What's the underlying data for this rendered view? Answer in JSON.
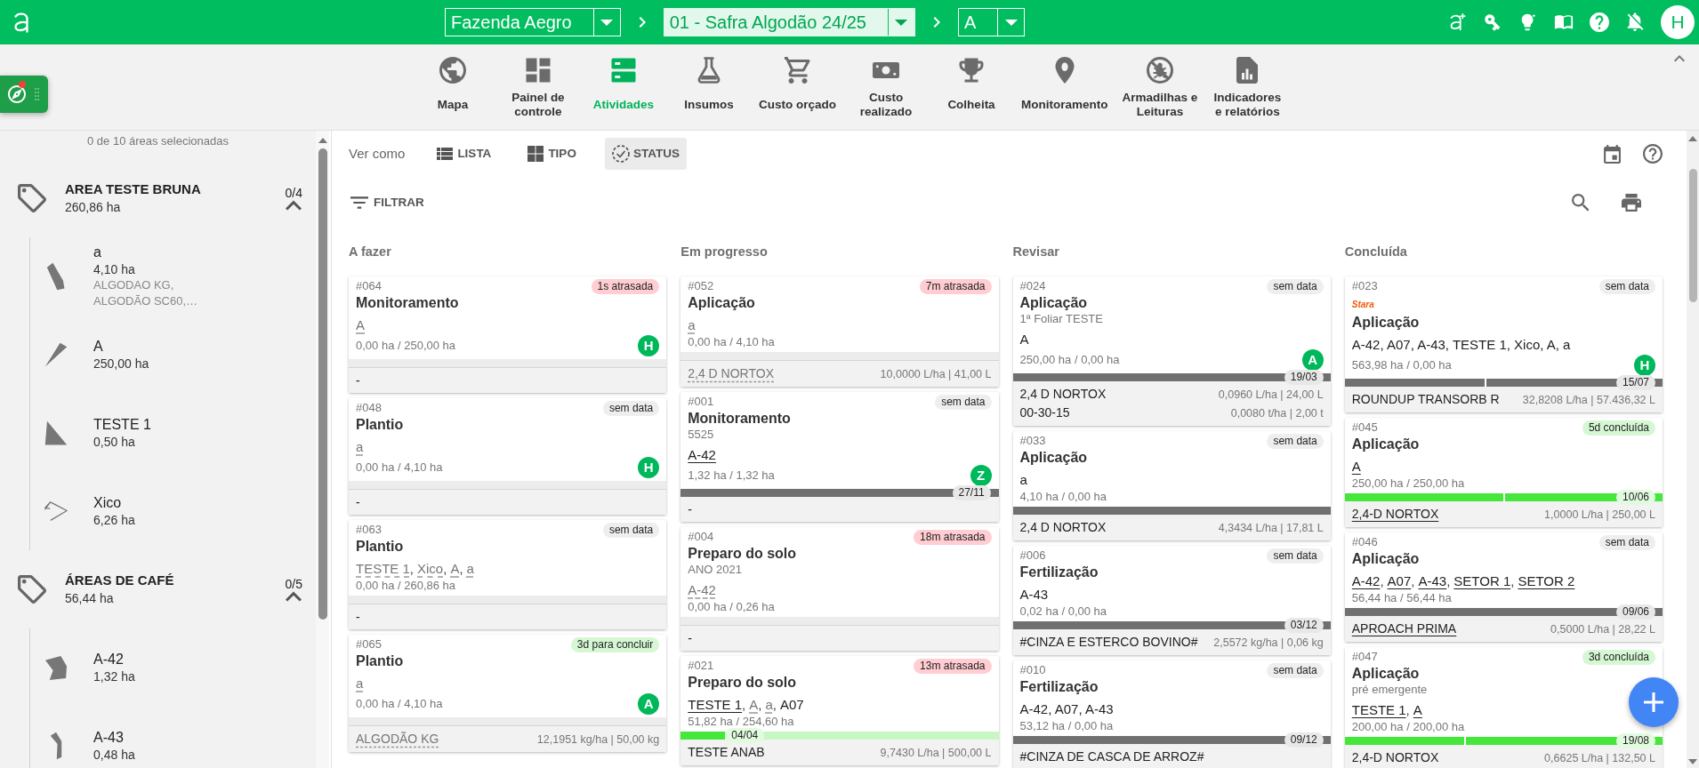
{
  "topbar": {
    "selectors": [
      {
        "label": "Fazenda Aegro",
        "active": false
      },
      {
        "label": "01 - Safra Algodão 24/25",
        "active": true
      },
      {
        "label": "A",
        "active": false
      }
    ],
    "avatar": "H"
  },
  "nav": {
    "items": [
      {
        "label": "Mapa",
        "selected": false
      },
      {
        "label": "Painel de\ncontrole",
        "selected": false
      },
      {
        "label": "Atividades",
        "selected": true
      },
      {
        "label": "Insumos",
        "selected": false
      },
      {
        "label": "Custo orçado",
        "selected": false
      },
      {
        "label": "Custo\nrealizado",
        "selected": false
      },
      {
        "label": "Colheita",
        "selected": false
      },
      {
        "label": "Monitoramento",
        "selected": false
      },
      {
        "label": "Armadilhas e\nLeituras",
        "selected": false
      },
      {
        "label": "Indicadores\ne relatórios",
        "selected": false
      }
    ]
  },
  "sidebar": {
    "summary": "0 de 10 áreas selecionadas",
    "groups": [
      {
        "name": "AREA TESTE BRUNA",
        "area": "260,86 ha",
        "count": "0/4",
        "expanded": true,
        "children": [
          {
            "name": "a",
            "area": "4,10 ha",
            "crops": "ALGODAO KG, ALGODÃO SC60,…"
          },
          {
            "name": "A",
            "area": "250,00 ha"
          },
          {
            "name": "TESTE 1",
            "area": "0,50 ha"
          },
          {
            "name": "Xico",
            "area": "6,26 ha"
          }
        ]
      },
      {
        "name": "ÁREAS DE CAFÉ",
        "area": "56,44 ha",
        "count": "0/5",
        "expanded": true,
        "children": [
          {
            "name": "A-42",
            "area": "1,32 ha"
          },
          {
            "name": "A-43",
            "area": "0,48 ha"
          }
        ]
      }
    ]
  },
  "view": {
    "label": "Ver como",
    "options": [
      {
        "label": "LISTA",
        "selected": false
      },
      {
        "label": "TIPO",
        "selected": false
      },
      {
        "label": "STATUS",
        "selected": true
      }
    ],
    "filter": "FILTRAR"
  },
  "columns": [
    {
      "title": "A fazer",
      "cards": [
        {
          "number": "#064",
          "badge": {
            "text": "1s atrasada",
            "color": "#ffcdd2"
          },
          "title": "Monitoramento",
          "areas": [
            {
              "name": "A",
              "kind": "dashed"
            }
          ],
          "ratio": "0,00 ha / 250,00 ha",
          "assignee": "H",
          "products": [
            {
              "name": "-",
              "kind": "plain"
            }
          ]
        },
        {
          "number": "#048",
          "badge": {
            "text": "sem data",
            "color": "#eeeeee"
          },
          "title": "Plantio",
          "areas": [
            {
              "name": "a",
              "kind": "dashed"
            }
          ],
          "ratio": "0,00 ha / 4,10 ha",
          "assignee": "H",
          "products": [
            {
              "name": "-",
              "kind": "plain"
            }
          ]
        },
        {
          "number": "#063",
          "badge": {
            "text": "sem data",
            "color": "#eeeeee"
          },
          "title": "Plantio",
          "areas": [
            {
              "name": "TESTE 1",
              "kind": "dashed",
              "suffix": ","
            },
            {
              "name": "Xico",
              "kind": "dashed",
              "suffix": ","
            },
            {
              "name": "A",
              "kind": "dashed",
              "suffix": ","
            },
            {
              "name": "a",
              "kind": "dashed"
            }
          ],
          "ratio": "0,00 ha / 260,86 ha",
          "products": [
            {
              "name": "-",
              "kind": "plain"
            }
          ]
        },
        {
          "number": "#065",
          "badge": {
            "text": "3d para concluir",
            "color": "#d5f7d3"
          },
          "title": "Plantio",
          "areas": [
            {
              "name": "a",
              "kind": "dashed"
            }
          ],
          "ratio": "0,00 ha / 4,10 ha",
          "assignee": "A",
          "products": [
            {
              "name": "ALGODÃO KG",
              "kind": "dashed",
              "dose": "12,1951 kg/ha | 50,00 kg"
            }
          ]
        }
      ]
    },
    {
      "title": "Em progresso",
      "cards": [
        {
          "number": "#052",
          "badge": {
            "text": "7m atrasada",
            "color": "#ffcdd2"
          },
          "title": "Aplicação",
          "areas": [
            {
              "name": "a",
              "kind": "dashed"
            }
          ],
          "ratio": "0,00 ha / 4,10 ha",
          "products": [
            {
              "name": "2,4 D NORTOX",
              "kind": "dashed",
              "dose": "10,0000 L/ha | 41,00 L"
            }
          ]
        },
        {
          "number": "#001",
          "badge": {
            "text": "sem data",
            "color": "#eeeeee"
          },
          "title": "Monitoramento",
          "subtitle": "5525",
          "areas": [
            {
              "name": "A-42",
              "kind": "link"
            }
          ],
          "ratio": "1,32 ha / 1,32 ha",
          "assignee": "Z",
          "progress": {
            "color": "#707070",
            "segments": [
              {
                "level": 1
              }
            ],
            "date": "27/11"
          },
          "products": [
            {
              "name": "-",
              "kind": "plain"
            }
          ]
        },
        {
          "number": "#004",
          "badge": {
            "text": "18m atrasada",
            "color": "#ffcdd2"
          },
          "title": "Preparo do solo",
          "subtitle": "ANO 2021",
          "areas": [
            {
              "name": "A-42",
              "kind": "dashed"
            }
          ],
          "ratio": "0,00 ha / 0,26 ha",
          "products": [
            {
              "name": "-",
              "kind": "plain"
            }
          ]
        },
        {
          "number": "#021",
          "badge": {
            "text": "13m atrasada",
            "color": "#ffcdd2"
          },
          "title": "Preparo do solo",
          "areas": [
            {
              "name": "TESTE 1",
              "kind": "link",
              "suffix": ","
            },
            {
              "name": "A",
              "kind": "dashed",
              "suffix": ","
            },
            {
              "name": "a",
              "kind": "dashed",
              "suffix": ","
            },
            {
              "name": "A07",
              "kind": "plain"
            }
          ],
          "ratio": "51,82 ha / 254,60 ha",
          "progress": {
            "color": "#45e83a",
            "segments": [
              {
                "level": 0.14
              }
            ],
            "date": "04/04"
          },
          "products": [
            {
              "name": "TESTE ANAB",
              "kind": "plain",
              "dose": "9,7430 L/ha | 500,00 L"
            }
          ]
        }
      ]
    },
    {
      "title": "Revisar",
      "cards": [
        {
          "number": "#024",
          "badge": {
            "text": "sem data",
            "color": "#eeeeee"
          },
          "title": "Aplicação",
          "subtitle": "1ª Foliar TESTE",
          "areas": [
            {
              "name": "A",
              "kind": "plain"
            }
          ],
          "ratio": "250,00 ha / 0,00 ha",
          "assignee": "A",
          "progress": {
            "color": "#707070",
            "segments": [
              {
                "level": 1
              }
            ],
            "date": "19/03"
          },
          "products": [
            {
              "name": "2,4 D NORTOX",
              "kind": "plain",
              "dose": "0,0960 L/ha | 24,00 L"
            },
            {
              "name": "00-30-15",
              "kind": "plain",
              "dose": "0,0080 t/ha | 2,00 t"
            }
          ]
        },
        {
          "number": "#033",
          "badge": {
            "text": "sem data",
            "color": "#eeeeee"
          },
          "title": "Aplicação",
          "areas": [
            {
              "name": "a",
              "kind": "plain"
            }
          ],
          "ratio": "4,10 ha / 0,00 ha",
          "progress": {
            "color": "#707070",
            "segments": [
              {
                "level": 1
              }
            ]
          },
          "products": [
            {
              "name": "2,4 D NORTOX",
              "kind": "plain",
              "dose": "4,3434 L/ha | 17,81 L"
            }
          ]
        },
        {
          "number": "#006",
          "badge": {
            "text": "sem data",
            "color": "#eeeeee"
          },
          "title": "Fertilização",
          "areas": [
            {
              "name": "A-43",
              "kind": "plain"
            }
          ],
          "ratio": "0,02 ha / 0,00 ha",
          "progress": {
            "color": "#707070",
            "segments": [
              {
                "level": 1
              }
            ],
            "date": "03/12"
          },
          "products": [
            {
              "name": "#CINZA E ESTERCO BOVINO#",
              "kind": "plain",
              "dose": "2,5572 kg/ha | 0,06 kg"
            }
          ]
        },
        {
          "number": "#010",
          "badge": {
            "text": "sem data",
            "color": "#eeeeee"
          },
          "title": "Fertilização",
          "areas": [
            {
              "name": "A-42, A07, A-43",
              "kind": "plain"
            }
          ],
          "ratio": "53,12 ha / 0,00 ha",
          "progress": {
            "color": "#707070",
            "segments": [
              {
                "level": 1
              }
            ],
            "date": "09/12"
          },
          "products": [
            {
              "name": "#CINZA DE CASCA DE ARROZ#",
              "kind": "plain"
            }
          ]
        }
      ]
    },
    {
      "title": "Concluída",
      "cards": [
        {
          "number": "#023",
          "badge": {
            "text": "sem data",
            "color": "#eeeeee"
          },
          "logo": "Stara",
          "title": "Aplicação",
          "areas": [
            {
              "name": "A-42, A07, A-43, TESTE 1, Xico, A, a",
              "kind": "plain"
            }
          ],
          "ratio": "563,98 ha / 0,00 ha",
          "assignee": "H",
          "progress": {
            "color": "#707070",
            "segments": [
              {
                "level": 0.44
              },
              {
                "level": 0.56
              }
            ],
            "date": "15/07"
          },
          "products": [
            {
              "name": "ROUNDUP TRANSORB R",
              "kind": "plain",
              "dose": "32,8208 L/ha | 57.436,32 L"
            }
          ]
        },
        {
          "number": "#045",
          "badge": {
            "text": "5d concluída",
            "color": "#d5f7d3"
          },
          "title": "Aplicação",
          "areas": [
            {
              "name": "A",
              "kind": "link"
            }
          ],
          "ratio": "250,00 ha / 250,00 ha",
          "progress": {
            "color": "#45e83a",
            "segments": [
              {
                "level": 0.5
              },
              {
                "level": 0.5
              }
            ],
            "date": "10/06"
          },
          "products": [
            {
              "name": "2,4-D NORTOX",
              "kind": "link",
              "dose": "1,0000 L/ha | 250,00 L"
            }
          ]
        },
        {
          "number": "#046",
          "badge": {
            "text": "sem data",
            "color": "#eeeeee"
          },
          "title": "Aplicação",
          "areas": [
            {
              "name": "A-42",
              "kind": "link",
              "suffix": ","
            },
            {
              "name": "A07",
              "kind": "link",
              "suffix": ","
            },
            {
              "name": "A-43",
              "kind": "link",
              "suffix": ","
            },
            {
              "name": "SETOR 1",
              "kind": "link",
              "suffix": ","
            },
            {
              "name": "SETOR 2",
              "kind": "link"
            }
          ],
          "ratio": "56,44 ha / 56,44 ha",
          "progress": {
            "color": "#707070",
            "segments": [
              {
                "level": 1
              }
            ],
            "date": "09/06"
          },
          "products": [
            {
              "name": "APROACH PRIMA",
              "kind": "link",
              "dose": "0,5000 L/ha | 28,22 L"
            }
          ]
        },
        {
          "number": "#047",
          "badge": {
            "text": "3d concluída",
            "color": "#d5f7d3"
          },
          "title": "Aplicação",
          "subtitle": "pré emergente",
          "areas": [
            {
              "name": "TESTE 1",
              "kind": "link",
              "suffix": ","
            },
            {
              "name": "A",
              "kind": "link"
            }
          ],
          "ratio": "200,00 ha / 200,00 ha",
          "progress": {
            "color": "#45e83a",
            "segments": [
              {
                "level": 0.375
              },
              {
                "level": 0.625
              }
            ],
            "date": "19/08"
          },
          "products": [
            {
              "name": "2,4-D NORTOX",
              "kind": "plain",
              "dose": "0,6625 L/ha | 132,50 L"
            }
          ]
        }
      ]
    }
  ]
}
